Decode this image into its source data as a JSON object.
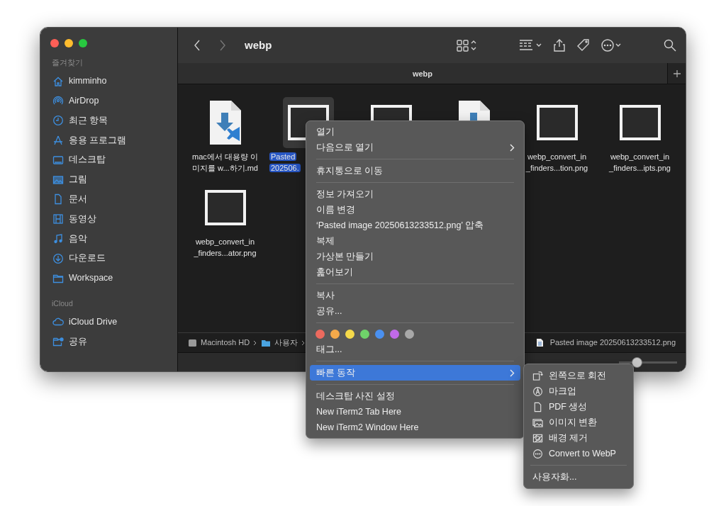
{
  "window": {
    "title": "webp",
    "tab": "webp"
  },
  "sidebar": [
    {
      "heading": "즐겨찾기",
      "items": [
        {
          "label": "kimminho"
        },
        {
          "label": "AirDrop"
        },
        {
          "label": "최근 항목"
        },
        {
          "label": "응용 프로그램"
        },
        {
          "label": "데스크탑"
        },
        {
          "label": "그림"
        },
        {
          "label": "문서"
        },
        {
          "label": "동영상"
        },
        {
          "label": "음악"
        },
        {
          "label": "다운로드"
        },
        {
          "label": "Workspace"
        }
      ]
    },
    {
      "heading": "iCloud",
      "items": [
        {
          "label": "iCloud Drive"
        },
        {
          "label": "공유"
        }
      ]
    }
  ],
  "files": [
    {
      "kind": "document",
      "lines": [
        "mac에서 대용량 이",
        "미지를 w...하기.md"
      ],
      "selected": false
    },
    {
      "kind": "image",
      "lines": [
        "Pasted",
        "202506."
      ],
      "selected": true
    },
    {
      "kind": "image",
      "selected": false
    },
    {
      "kind": "document",
      "selected": false
    },
    {
      "kind": "image",
      "lines": [
        "webp_convert_in",
        "_finders...tion.png"
      ],
      "selected": false
    },
    {
      "kind": "image",
      "lines": [
        "webp_convert_in",
        "_finders...ipts.png"
      ],
      "selected": false
    },
    {
      "kind": "image",
      "lines": [
        "webp_convert_in",
        "_finders...ator.png"
      ],
      "selected": false
    }
  ],
  "path_bar": {
    "segments": [
      "Macintosh HD",
      "사용자"
    ],
    "file": "Pasted image 20250613233512.png"
  },
  "zoom_slider": {
    "level": 0.27
  },
  "context_menu": [
    {
      "items": [
        {
          "label": "열기",
          "submenu": false,
          "selected": false
        },
        {
          "label": "다음으로 열기",
          "submenu": true,
          "selected": false
        }
      ]
    },
    {
      "items": [
        {
          "label": "휴지통으로 이동",
          "submenu": false,
          "selected": false
        }
      ]
    },
    {
      "items": [
        {
          "label": "정보 가져오기",
          "submenu": false,
          "selected": false
        },
        {
          "label": "이름 변경",
          "submenu": false,
          "selected": false
        },
        {
          "label": "‘Pasted image 20250613233512.png’ 압축",
          "submenu": false,
          "selected": false
        },
        {
          "label": "복제",
          "submenu": false,
          "selected": false
        },
        {
          "label": "가상본 만들기",
          "submenu": false,
          "selected": false
        },
        {
          "label": "훑어보기",
          "submenu": false,
          "selected": false
        }
      ]
    },
    {
      "items": [
        {
          "label": "복사",
          "submenu": false,
          "selected": false
        },
        {
          "label": "공유...",
          "submenu": false,
          "selected": false
        }
      ]
    },
    {
      "tag_colors": [
        {
          "color": "#ec6a5e"
        },
        {
          "color": "#f4a94a"
        },
        {
          "color": "#f5d94a"
        },
        {
          "color": "#6fd36a"
        },
        {
          "color": "#4a90f0"
        },
        {
          "color": "#c06ae8"
        },
        {
          "color": "#a8a8a8"
        }
      ],
      "items": [
        {
          "label": "태그...",
          "submenu": false,
          "selected": false
        }
      ]
    },
    {
      "items": [
        {
          "label": "빠른 동작",
          "submenu": true,
          "selected": true
        }
      ]
    },
    {
      "items": [
        {
          "label": "데스크탑 사진 설정",
          "submenu": false,
          "selected": false
        },
        {
          "label": "New iTerm2 Tab Here",
          "submenu": false,
          "selected": false
        },
        {
          "label": "New iTerm2 Window Here",
          "submenu": false,
          "selected": false
        }
      ]
    }
  ],
  "quick_actions_menu": [
    {
      "items": [
        {
          "label": "왼쪽으로 회전"
        },
        {
          "label": "마크업"
        },
        {
          "label": "PDF 생성"
        },
        {
          "label": "이미지 변환"
        },
        {
          "label": "배경 제거"
        },
        {
          "label": "Convert to WebP"
        }
      ]
    },
    {
      "items": [
        {
          "label": "사용자화..."
        }
      ]
    }
  ]
}
